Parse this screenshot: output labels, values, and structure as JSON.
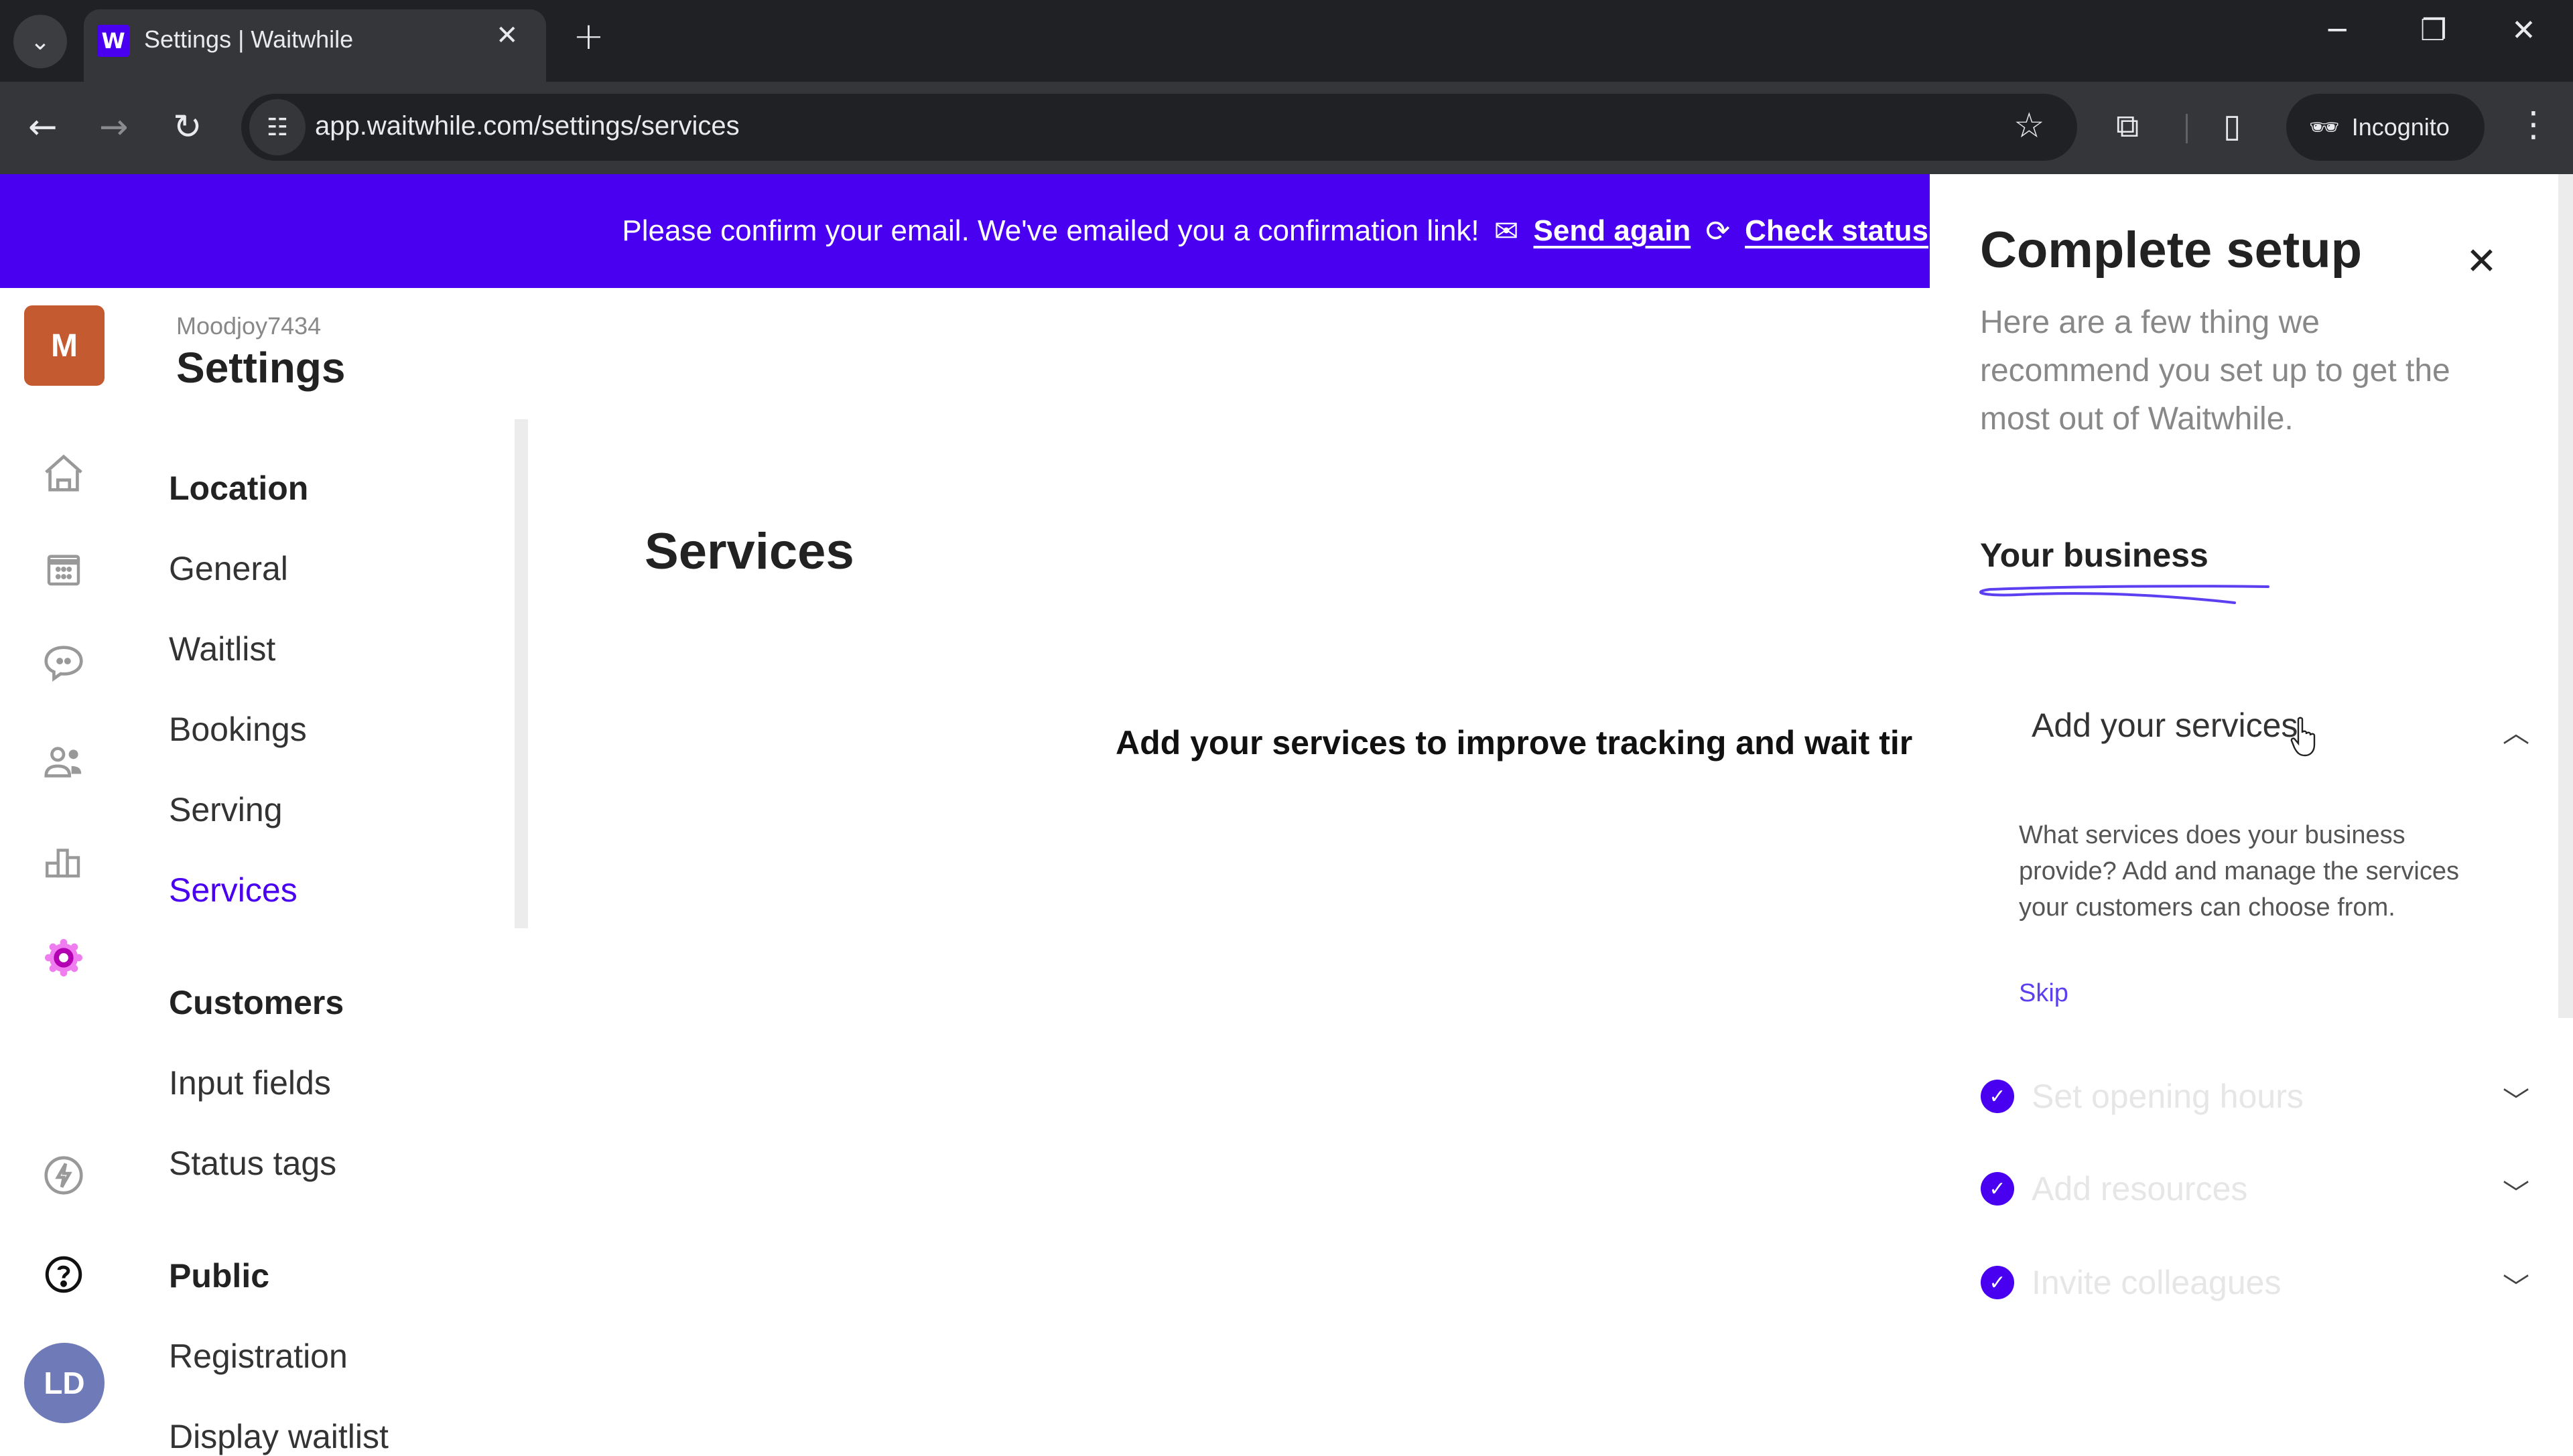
{
  "browser": {
    "tab_title": "Settings | Waitwhile",
    "favicon_letter": "W",
    "url": "app.waitwhile.com/settings/services",
    "incognito_label": "Incognito",
    "icons": {
      "tab_search": "chevron-down-icon",
      "close_tab": "close-icon",
      "new_tab": "plus-icon",
      "back": "arrow-left-icon",
      "forward": "arrow-right-icon",
      "reload": "reload-icon",
      "site_info": "tune-icon",
      "bookmark": "star-icon",
      "extensions": "puzzle-icon",
      "side_panel": "side-panel-icon",
      "incognito": "incognito-icon",
      "menu": "kebab-menu-icon",
      "minimize": "minimize-icon",
      "restore": "restore-icon",
      "close_window": "close-icon"
    }
  },
  "banner": {
    "message": "Please confirm your email. We've emailed you a confirmation link!",
    "send_again": "Send again",
    "check_status": "Check status",
    "color": "#4a00f0"
  },
  "rail": {
    "org_initial": "M",
    "org_color": "#c45a30",
    "user_initials": "LD",
    "user_color": "#6f7ab8",
    "icons": [
      "home-icon",
      "calendar-icon",
      "chat-icon",
      "customers-icon",
      "analytics-icon",
      "settings-gear-icon",
      "lightning-icon",
      "help-icon"
    ]
  },
  "settings_nav": {
    "org_name": "Moodjoy7434",
    "title": "Settings",
    "sections": [
      {
        "heading": "Location",
        "items": [
          "General",
          "Waitlist",
          "Bookings",
          "Serving",
          "Services"
        ]
      },
      {
        "heading": "Customers",
        "items": [
          "Input fields",
          "Status tags"
        ]
      },
      {
        "heading": "Public",
        "items": [
          "Registration",
          "Display waitlist"
        ]
      }
    ],
    "active_item": "Services",
    "accent": "#4a00f0"
  },
  "main": {
    "title": "Services",
    "message": "Add your services to improve tracking and wait tir"
  },
  "setup_panel": {
    "title": "Complete setup",
    "description": "Here are a few thing we recommend you set up to get the most out of Waitwhile.",
    "section": "Your business",
    "steps": [
      {
        "label": "Add your services",
        "expanded": true,
        "completed": false,
        "body": "What services does your business provide? Add and manage the services your customers can choose from.",
        "action": "Skip"
      },
      {
        "label": "Set opening hours",
        "expanded": false,
        "completed": true
      },
      {
        "label": "Add resources",
        "expanded": false,
        "completed": true
      },
      {
        "label": "Invite colleagues",
        "expanded": false,
        "completed": true
      }
    ]
  }
}
